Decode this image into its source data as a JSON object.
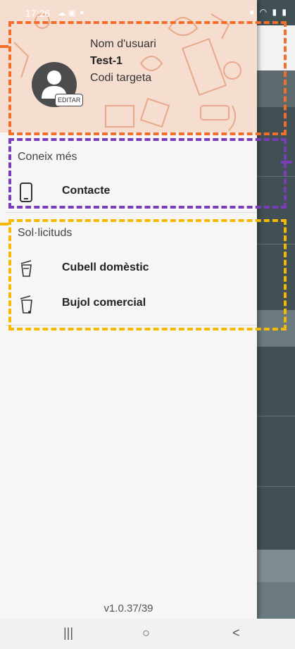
{
  "status_bar": {
    "time": "17:26"
  },
  "drawer": {
    "profile": {
      "user_label": "Nom d'usuari",
      "user_value": "Test-1",
      "card_label": "Codi targeta",
      "edit_label": "EDITAR"
    },
    "sections": [
      {
        "title": "Coneix més",
        "items": [
          {
            "label": "Contacte",
            "icon": "phone-icon"
          }
        ]
      },
      {
        "title": "Sol·licituds",
        "items": [
          {
            "label": "Cubell domèstic",
            "icon": "bucket-icon"
          },
          {
            "label": "Bujol comercial",
            "icon": "bin-icon"
          }
        ]
      }
    ],
    "version": "v1.0.37/39"
  },
  "annotation_colors": {
    "orange": "#f26e2b",
    "purple": "#7a3db8",
    "yellow": "#f6b800"
  },
  "navbar": {
    "recents": "|||",
    "home": "○",
    "back": "<"
  }
}
